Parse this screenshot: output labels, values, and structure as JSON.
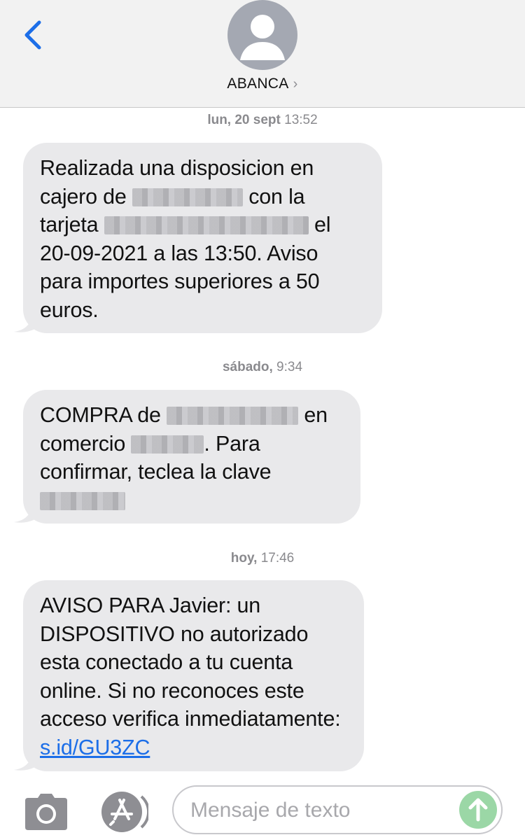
{
  "header": {
    "contact_name": "ABANCA",
    "contact_chevron": "›",
    "back_icon": "chevron-left-icon",
    "avatar_icon": "person-silhouette-icon"
  },
  "thread": [
    {
      "timestamp_day": "lun, 20 sept",
      "timestamp_time": "13:52",
      "text_parts": {
        "p1": "Realizada una disposicion en cajero de",
        "p2": "con la tarjeta",
        "p3": "el 20-09-2021 a las 13:50. Aviso para importes superiores a 50 euros."
      }
    },
    {
      "timestamp_day": "sábado,",
      "timestamp_time": "9:34",
      "text_parts": {
        "p1": "COMPRA de",
        "p2": "en comercio",
        "p3": ". Para confirmar, teclea la clave"
      }
    },
    {
      "timestamp_day": "hoy,",
      "timestamp_time": "17:46",
      "text_parts": {
        "p1": "AVISO PARA Javier: un DISPOSITIVO no autorizado esta conectado a tu cuenta online. Si no reconoces este acceso verifica inmediatamente:",
        "link": "s.id/GU3ZC"
      }
    }
  ],
  "input_bar": {
    "placeholder": "Mensaje de texto",
    "value": "",
    "camera_icon": "camera-icon",
    "apps_icon": "app-store-icon",
    "send_icon": "arrow-up-icon"
  },
  "colors": {
    "header_bg": "#f2f2f2",
    "bubble_bg": "#e9e9eb",
    "link": "#1c6ee8",
    "back_chevron": "#1c6ee8",
    "send_button": "#9bd7a6",
    "avatar": "#a4a8b2"
  }
}
